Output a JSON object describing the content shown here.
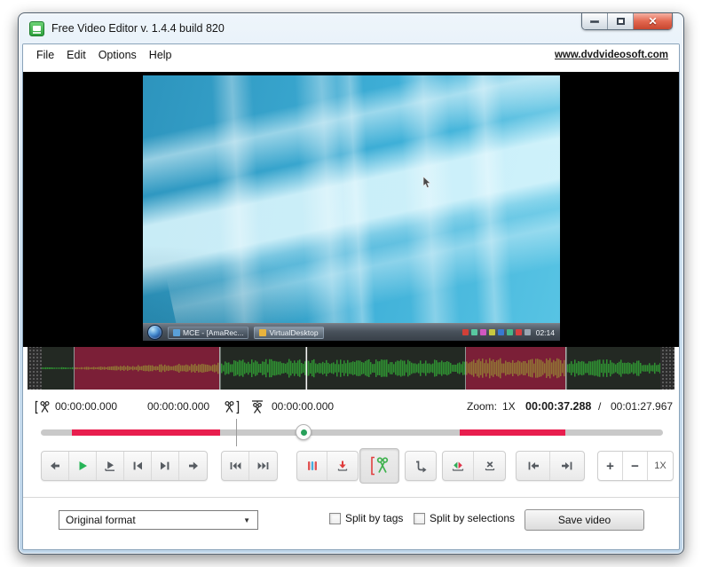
{
  "window": {
    "title": "Free Video Editor v. 1.4.4 build 820"
  },
  "menu": {
    "items": [
      "File",
      "Edit",
      "Options",
      "Help"
    ],
    "website_link": "www.dvdvideosoft.com"
  },
  "player": {
    "taskbar": {
      "apps": [
        {
          "label": "MCE - [AmaRec..."
        },
        {
          "label": "VirtualDesktop"
        }
      ],
      "clock": "02:14"
    }
  },
  "times": {
    "selection_start": "00:00:00.000",
    "selection_end": "00:00:00.000",
    "cut_position": "00:00:00.000",
    "zoom_label": "Zoom:",
    "zoom_value": "1X",
    "current_time": "00:00:37.288",
    "divider": "/",
    "total_time": "00:01:27.967"
  },
  "toolbar": {
    "plus_label": "+",
    "minus_label": "−",
    "zoom_reset_label": "1X"
  },
  "footer": {
    "format_value": "Original format",
    "split_tags_label": "Split by tags",
    "split_selections_label": "Split by selections",
    "save_label": "Save video"
  },
  "colors": {
    "selection_red": "#e81e4e",
    "waveform_green": "#2f9132",
    "waveform_selected": "#907434",
    "timeline_selection_bg": "#7b1f37",
    "play_green": "#27b457",
    "accent_blue_bar": "#45aede",
    "accent_red_bar": "#e05555"
  }
}
